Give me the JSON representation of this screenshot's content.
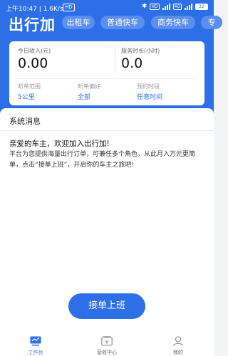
{
  "status_bar": {
    "time": "上午10:47",
    "speed": "1.6K/s",
    "hd": "HD",
    "network": "4G",
    "battery": "22"
  },
  "header": {
    "title": "出行加",
    "tabs": [
      {
        "label": "出租车"
      },
      {
        "label": "普通快车"
      },
      {
        "label": "商务快车"
      },
      {
        "label": "专"
      }
    ]
  },
  "summary": {
    "income_label": "今日收入(元)",
    "income_value": "0.00",
    "duration_label": "服务时长(小时)",
    "duration_value": "0.0",
    "range_label": "听单范围",
    "range_value": "5公里",
    "preference_label": "听单偏好",
    "preference_value": "全部",
    "booking_label": "预约时段",
    "booking_value": "任意时间"
  },
  "notice": {
    "title": "系统消息",
    "greeting": "亲爱的车主，欢迎加入出行加!",
    "message": "平台为您提供海量出行订单，可兼任多个角色，从此月入万元更简单，点击“接单上班”，开启你的车主之旅吧!"
  },
  "start_button": "接单上班",
  "tabbar": [
    {
      "label": "工作台",
      "icon": "workbench-icon",
      "active": true
    },
    {
      "label": "营收中心",
      "icon": "wallet-icon",
      "active": false
    },
    {
      "label": "我的",
      "icon": "user-icon",
      "active": false
    }
  ],
  "colors": {
    "primary": "#2d6fe6",
    "tab_bg": "#5a8ef0"
  }
}
